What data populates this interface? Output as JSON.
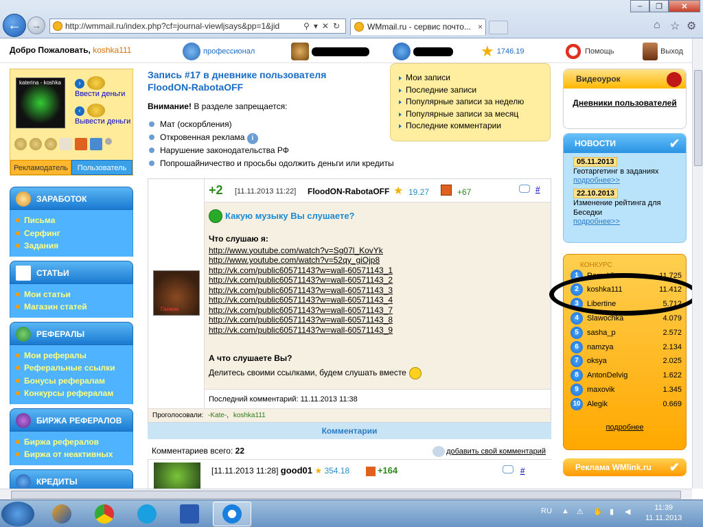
{
  "browser": {
    "url": "http://wmmail.ru/index.php?cf=journal-viewljsays&pp=1&jid",
    "tab_title": "WMmail.ru - сервис почто...",
    "tab_close": "×"
  },
  "topbar": {
    "welcome_label": "Добро Пожаловать,",
    "username": "koshka111",
    "status": "профессионал",
    "credits_balance": "1746.19",
    "help": "Помощь",
    "logout": "Выход"
  },
  "user": {
    "avatar_caption": "katerina - koshka",
    "deposit": "Ввести деньги",
    "withdraw": "Вывести деньги",
    "role_advertiser": "Рекламодатель",
    "role_user": "Пользователь"
  },
  "menu": {
    "earnings": {
      "title": "ЗАРАБОТОК",
      "items": [
        "Письма",
        "Серфинг",
        "Задания"
      ]
    },
    "articles": {
      "title": "СТАТЬИ",
      "items": [
        "Мои статьи",
        "Магазин статей"
      ]
    },
    "referrals": {
      "title": "РЕФЕРАЛЫ",
      "items": [
        "Мои рефералы",
        "Реферальные ссылки",
        "Бонусы рефералам",
        "Конкурсы рефералам"
      ]
    },
    "ref_exchange": {
      "title": "БИРЖА РЕФЕРАЛОВ",
      "items": [
        "Биржа рефералов",
        "Биржа от неактивных"
      ]
    },
    "credits": {
      "title": "КРЕДИТЫ"
    }
  },
  "page": {
    "title_line1": "Запись #17 в дневнике пользователя",
    "title_line2": "FloodON-RabotaOFF",
    "warning_bold": "Внимание!",
    "warning_text": " В разделе запрещается:",
    "rules": [
      "Мат (оскорбления)",
      "Откровенная реклама",
      "Нарушение законодательства РФ",
      "Попрошайничество и просьбы одолжить деньги или кредиты"
    ]
  },
  "quicklinks": [
    "Мои записи",
    "Последние записи",
    "Популярные записи за неделю",
    "Популярные записи за месяц",
    "Последние комментарии"
  ],
  "post": {
    "votes": "+2",
    "date": "[11.11.2013 11:22]",
    "author": "FloodON-RabotaOFF",
    "rating": "19.27",
    "plus": "+67",
    "hash": "#",
    "title": "Какую музыку Вы слушаете?",
    "listening_label": "Что слушаю я:",
    "links": [
      "http://www.youtube.com/watch?v=Sg07l_KovYk",
      "http://www.youtube.com/watch?v=52qy_giOjp8",
      "http://vk.com/public60571143?w=wall-60571143_1",
      "http://vk.com/public60571143?w=wall-60571143_2",
      "http://vk.com/public60571143?w=wall-60571143_3",
      "http://vk.com/public60571143?w=wall-60571143_4",
      "http://vk.com/public60571143?w=wall-60571143_7",
      "http://vk.com/public60571143?w=wall-60571143_8",
      "http://vk.com/public60571143?w=wall-60571143_9"
    ],
    "question": "А что слушаете Вы?",
    "invite": "Делитесь своими ссылками, будем слушать вместе",
    "last_comment": "Последний комментарий: 11.11.2013 11:38",
    "voted_label": "Проголосовали:",
    "voters": [
      "-Kate-",
      "koshka111"
    ],
    "avatar_caption": "Ганжик"
  },
  "comments": {
    "header": "Комментарии",
    "total_label": "Комментариев всего:",
    "total": "22",
    "add": "добавить свой комментарий",
    "first": {
      "date": "[11.11.2013 11:28]",
      "author": "good01",
      "rating": "354.18",
      "plus": "+164",
      "hash": "#"
    }
  },
  "sidebar": {
    "video_title": "Видеоурок",
    "video_link": "Дневники пользователей",
    "news_title": "НОВОСТИ",
    "news": [
      {
        "date": "05.11.2013",
        "text": "Геотаргетинг в заданиях",
        "more": "подробнее>>"
      },
      {
        "date": "22.10.2013",
        "text": "Изменение рейтинга для Беседки",
        "more": "подробнее>>"
      }
    ],
    "contest_title": "КОНКУРС",
    "contest": [
      {
        "n": "1",
        "name": "RomaVin",
        "score": "11.725"
      },
      {
        "n": "2",
        "name": "koshka111",
        "score": "11.412"
      },
      {
        "n": "3",
        "name": "Libertine",
        "score": "5.712"
      },
      {
        "n": "4",
        "name": "Slawochka",
        "score": "4.079"
      },
      {
        "n": "5",
        "name": "sasha_p",
        "score": "2.572"
      },
      {
        "n": "6",
        "name": "namzya",
        "score": "2.134"
      },
      {
        "n": "7",
        "name": "oksya",
        "score": "2.025"
      },
      {
        "n": "8",
        "name": "AntonDelvig",
        "score": "1.622"
      },
      {
        "n": "9",
        "name": "maxovik",
        "score": "1.345"
      },
      {
        "n": "10",
        "name": "Alegik",
        "score": "0.669"
      }
    ],
    "contest_more": "подробнее",
    "wmlink": "Реклама WMlink.ru"
  },
  "taskbar": {
    "lang": "RU",
    "time": "11:39",
    "date": "11.11.2013"
  }
}
